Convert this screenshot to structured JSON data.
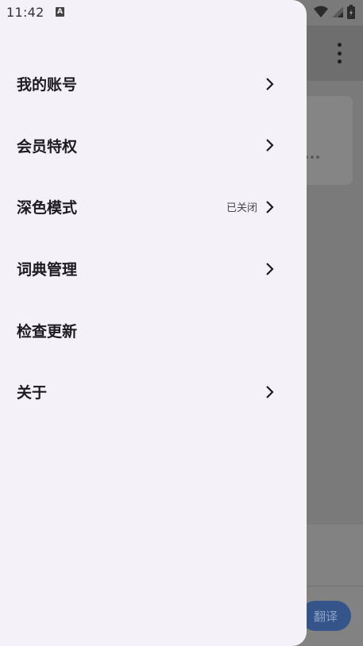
{
  "status_bar": {
    "time": "11:42",
    "icons": [
      "text-input-icon",
      "wifi-icon",
      "signal-icon",
      "battery-charging-icon"
    ]
  },
  "drawer": {
    "items": [
      {
        "label": "我的账号",
        "value": "",
        "chevron": true
      },
      {
        "label": "会员特权",
        "value": "",
        "chevron": true
      },
      {
        "label": "深色模式",
        "value": "已关闭",
        "chevron": true
      },
      {
        "label": "词典管理",
        "value": "",
        "chevron": true
      },
      {
        "label": "检查更新",
        "value": "",
        "chevron": false
      },
      {
        "label": "关于",
        "value": "",
        "chevron": true
      }
    ]
  },
  "background": {
    "translate_button": "翻译"
  }
}
